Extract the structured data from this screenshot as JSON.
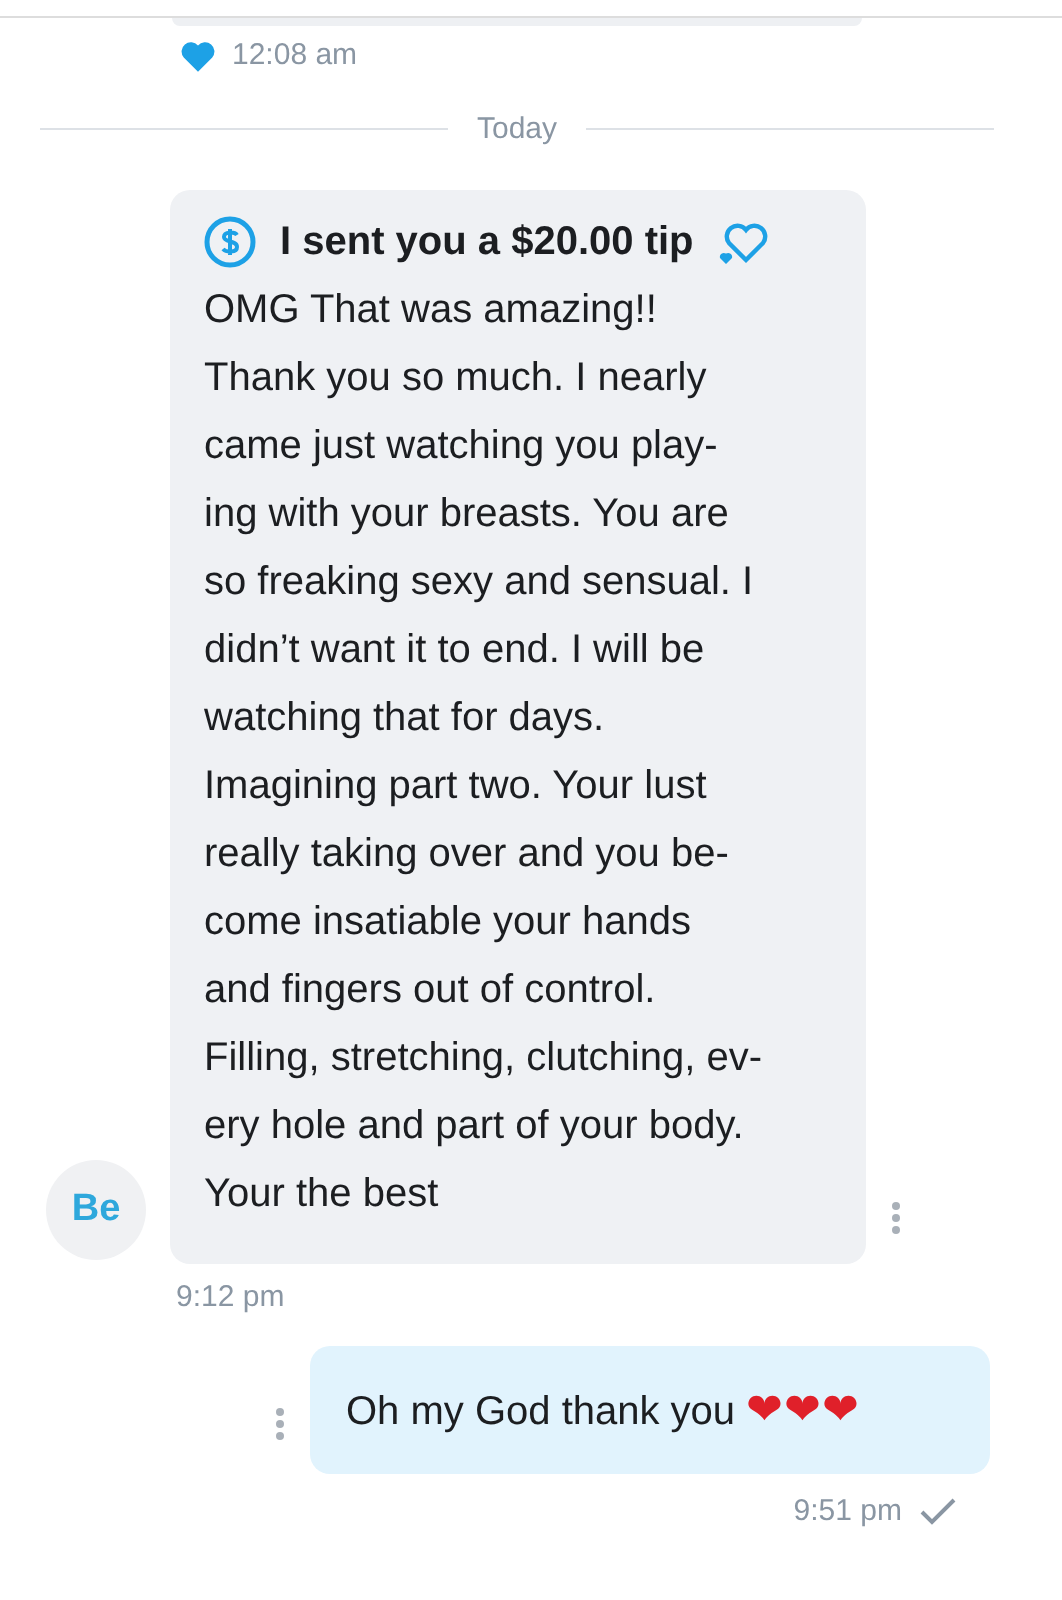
{
  "earlier_message": {
    "time": "12:08 am",
    "liked": true
  },
  "date_divider": "Today",
  "messages": [
    {
      "kind": "received",
      "avatar": "Be",
      "tip": "I sent you a $20.00 tip",
      "lines": [
        "OMG That was amazing!!",
        "Thank you so much. I nearly",
        "came just watching you play-",
        "ing with your breasts. You are",
        "so freaking sexy and sensual. I",
        "didn’t want it to end. I will be",
        "watching that for days.",
        "Imagining part two. Your lust",
        "really taking over and you be-",
        "come insatiable your hands",
        "and fingers out of control.",
        "Filling, stretching, clutching, ev-",
        "ery hole and part of your body.",
        "Your the best"
      ],
      "time": "9:12 pm"
    },
    {
      "kind": "sent",
      "text": "Oh my God thank you",
      "emoji": "❤❤❤",
      "time": "9:51 pm",
      "read": false
    }
  ]
}
